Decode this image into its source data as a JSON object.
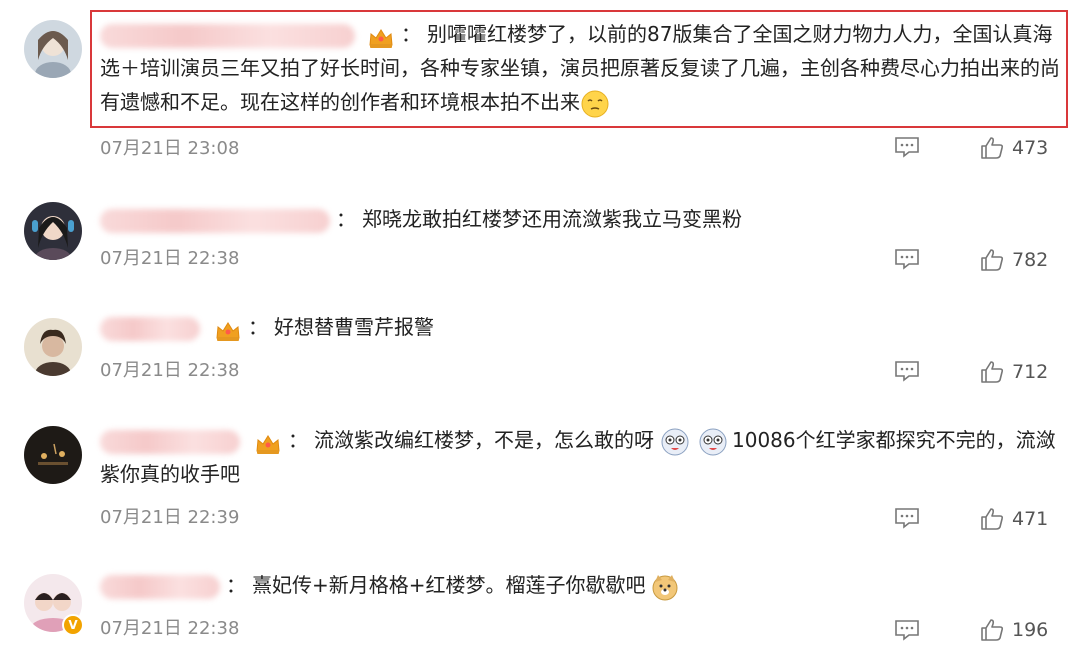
{
  "comments": [
    {
      "text": "别嚯嚯红楼梦了，以前的87版集合了全国之财力物力人力，全国认真海选＋培训演员三年又拍了好长时间，各种专家坐镇，演员把原著反复读了几遍，主创各种费尽心力拍出来的尚有遗憾和不足。现在这样的创作者和环境根本拍不出来",
      "time": "07月21日 23:08",
      "likes": "473",
      "has_crown": true,
      "highlighted": true
    },
    {
      "text": "郑晓龙敢拍红楼梦还用流潋紫我立马变黑粉",
      "time": "07月21日 22:38",
      "likes": "782",
      "has_crown": false
    },
    {
      "text": "好想替曹雪芹报警",
      "time": "07月21日 22:38",
      "likes": "712",
      "has_crown": true
    },
    {
      "text_a": "流潋紫改编红楼梦，不是，怎么敢的呀",
      "text_b": "10086个红学家都探究不完的，流潋紫你真的收手吧",
      "time": "07月21日 22:39",
      "likes": "471",
      "has_crown": true
    },
    {
      "text": "熹妃传+新月格格+红楼梦。榴莲子你歇歇吧",
      "time": "07月21日 22:38",
      "likes": "196",
      "has_crown": false,
      "verified": true
    }
  ],
  "separator": "：",
  "verified_mark": "V",
  "colors": {
    "highlight_border": "#d9383a",
    "meta_text": "#8a8a8a",
    "crown": "#f0a020"
  },
  "icons": [
    "reply-icon",
    "thumbs-up-icon",
    "crown-icon",
    "emoji-icon",
    "verified-icon"
  ]
}
